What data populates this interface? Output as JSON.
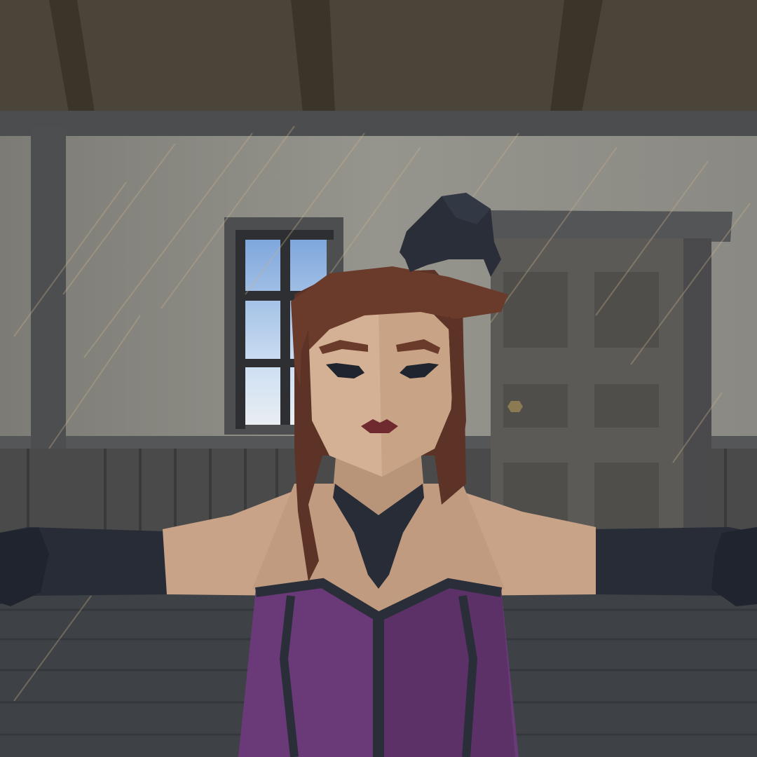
{
  "scene": {
    "setting": "saloon-interior",
    "weather": "rain",
    "colors": {
      "ceiling": "#4a4438",
      "beam": "#3b3529",
      "wall": "#8e8c84",
      "frame": "#4f5052",
      "wainscot": "#4a4a4a",
      "floor": "#3d4044",
      "sky": "#8fb6e6",
      "door": "#5e5c58",
      "skin": "#c9a387",
      "hair": "#6a3a2a",
      "glove": "#262b36",
      "dress": "#6a3a78",
      "lips": "#6e2a2e",
      "hat": "#2a2e38"
    }
  },
  "character": {
    "pose": "t-pose",
    "outfit": "purple-corset-dress"
  }
}
